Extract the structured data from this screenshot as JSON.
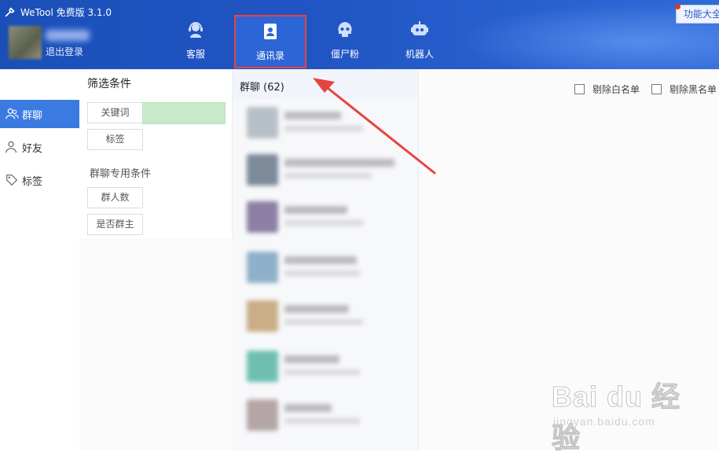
{
  "app": {
    "title": "WeTool 免费版 3.1.0"
  },
  "user": {
    "logout_label": "退出登录"
  },
  "tabs": [
    {
      "label": "客服",
      "icon": "headset-icon"
    },
    {
      "label": "通讯录",
      "icon": "contacts-icon",
      "active": true
    },
    {
      "label": "僵尸粉",
      "icon": "skull-icon"
    },
    {
      "label": "机器人",
      "icon": "robot-icon"
    }
  ],
  "header_right": {
    "func_label": "功能大全"
  },
  "leftnav": [
    {
      "label": "群聊",
      "icon": "group-chat-icon",
      "active": true
    },
    {
      "label": "好友",
      "icon": "friend-icon"
    },
    {
      "label": "标签",
      "icon": "tag-icon"
    }
  ],
  "filter": {
    "title": "筛选条件",
    "keyword_label": "关键词",
    "tag_label": "标签",
    "group_section_title": "群聊专用条件",
    "member_count_label": "群人数",
    "is_owner_label": "是否群主"
  },
  "group_list": {
    "title": "群聊 (62)"
  },
  "right_panel": {
    "remove_whitelist_label": "剔除白名单",
    "remove_blacklist_label": "剔除黑名单"
  },
  "watermark": {
    "brand": "Bai du 经验",
    "url": "jingyan.baidu.com"
  },
  "colors": {
    "header_blue": "#1b4fb8",
    "accent": "#3b7ae0",
    "highlight_red": "#e8433f"
  }
}
